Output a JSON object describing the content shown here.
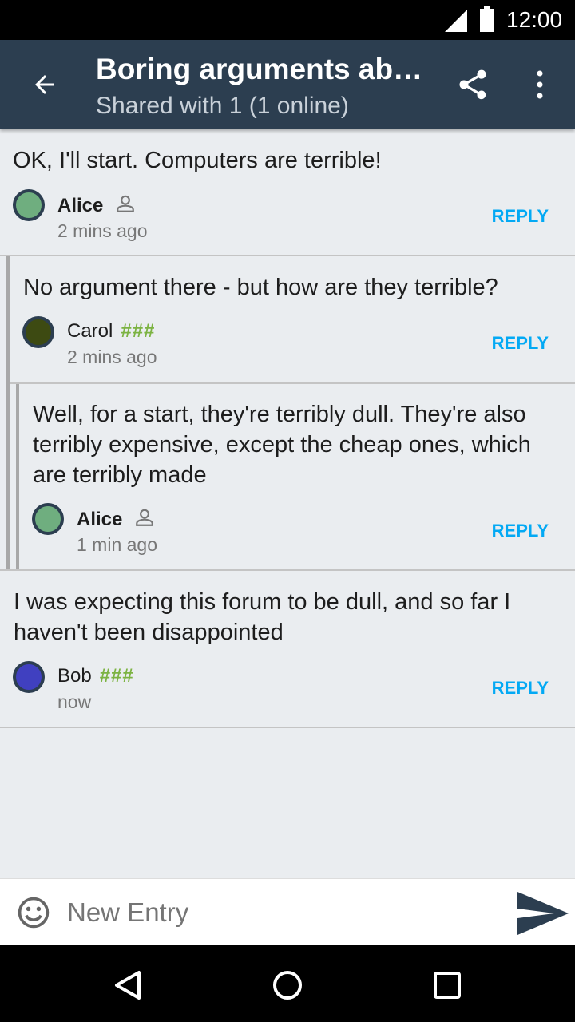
{
  "status_bar": {
    "time": "12:00"
  },
  "app_bar": {
    "title": "Boring arguments ab…",
    "subtitle": "Shared with 1 (1 online)"
  },
  "comments": [
    {
      "text": "OK, I'll start. Computers are terrible!",
      "author": "Alice",
      "badge": "person-icon",
      "time": "2 mins ago",
      "reply": "REPLY",
      "avatar_color": "#6fae7f"
    },
    {
      "text": "No argument there - but how are they terrible?",
      "author": "Carol",
      "tag": "###",
      "time": "2 mins ago",
      "reply": "REPLY",
      "avatar_color": "#3d4a12"
    },
    {
      "text": "Well, for a start, they're terribly dull. They're also terribly expensive, except the cheap ones, which are terribly made",
      "author": "Alice",
      "badge": "person-icon",
      "time": "1 min ago",
      "reply": "REPLY",
      "avatar_color": "#6fae7f"
    },
    {
      "text": "I was expecting this forum to be dull, and so far I haven't been disappointed",
      "author": "Bob",
      "tag": "###",
      "time": "now",
      "reply": "REPLY",
      "avatar_color": "#4040c0"
    }
  ],
  "composer": {
    "placeholder": "New Entry"
  },
  "colors": {
    "appbar": "#2c3e50",
    "accent": "#03a9f4",
    "tag": "#7cb342",
    "background": "#eaedf0"
  }
}
